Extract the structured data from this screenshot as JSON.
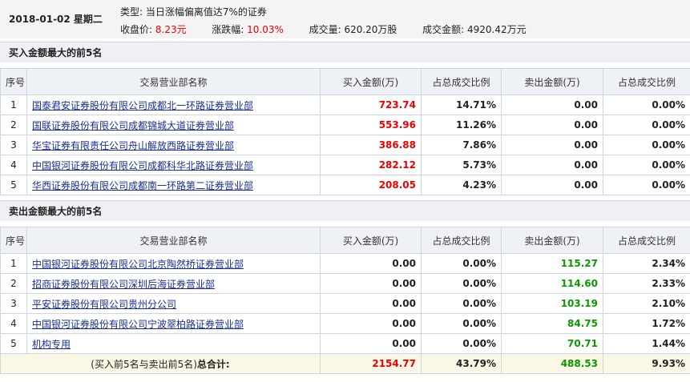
{
  "header": {
    "date": "2018-01-02 星期二",
    "type_label": "类型:",
    "type_value": "当日涨幅偏离值达7%的证券",
    "close_label": "收盘价:",
    "close_value": "8.23元",
    "change_label": "涨跌幅:",
    "change_value": "10.03%",
    "volume_label": "成交量:",
    "volume_value": "620.20万股",
    "amount_label": "成交金额:",
    "amount_value": "4920.42万元"
  },
  "buy_section": {
    "title": "买入金额最大的前5名",
    "columns": [
      "序号",
      "交易营业部名称",
      "买入金额(万)",
      "占总成交比例",
      "卖出金额(万)",
      "占总成交比例"
    ],
    "rows": [
      {
        "no": "1",
        "name": "国泰君安证券股份有限公司成都北一环路证券营业部",
        "buy": "723.74",
        "buy_pct": "14.71%",
        "sell": "0.00",
        "sell_pct": "0.00%"
      },
      {
        "no": "2",
        "name": "国联证券股份有限公司成都锦城大道证券营业部",
        "buy": "553.96",
        "buy_pct": "11.26%",
        "sell": "0.00",
        "sell_pct": "0.00%"
      },
      {
        "no": "3",
        "name": "华宝证券有限责任公司舟山解放西路证券营业部",
        "buy": "386.88",
        "buy_pct": "7.86%",
        "sell": "0.00",
        "sell_pct": "0.00%"
      },
      {
        "no": "4",
        "name": "中国银河证券股份有限公司成都科华北路证券营业部",
        "buy": "282.12",
        "buy_pct": "5.73%",
        "sell": "0.00",
        "sell_pct": "0.00%"
      },
      {
        "no": "5",
        "name": "华西证券股份有限公司成都南一环路第二证券营业部",
        "buy": "208.05",
        "buy_pct": "4.23%",
        "sell": "0.00",
        "sell_pct": "0.00%"
      }
    ]
  },
  "sell_section": {
    "title": "卖出金额最大的前5名",
    "columns": [
      "序号",
      "交易营业部名称",
      "买入金额(万)",
      "占总成交比例",
      "卖出金额(万)",
      "占总成交比例"
    ],
    "rows": [
      {
        "no": "1",
        "name": "中国银河证券股份有限公司北京陶然桥证券营业部",
        "buy": "0.00",
        "buy_pct": "0.00%",
        "sell": "115.27",
        "sell_pct": "2.34%"
      },
      {
        "no": "2",
        "name": "招商证券股份有限公司深圳后海证券营业部",
        "buy": "0.00",
        "buy_pct": "0.00%",
        "sell": "114.60",
        "sell_pct": "2.33%"
      },
      {
        "no": "3",
        "name": "平安证券股份有限公司贵州分公司",
        "buy": "0.00",
        "buy_pct": "0.00%",
        "sell": "103.19",
        "sell_pct": "2.10%"
      },
      {
        "no": "4",
        "name": "中国银河证券股份有限公司宁波翠柏路证券营业部",
        "buy": "0.00",
        "buy_pct": "0.00%",
        "sell": "84.75",
        "sell_pct": "1.72%"
      },
      {
        "no": "5",
        "name": "机构专用",
        "buy": "0.00",
        "buy_pct": "0.00%",
        "sell": "70.71",
        "sell_pct": "1.44%"
      }
    ],
    "total": {
      "label_prefix": "(买入前5名与卖出前5名)",
      "label_bold": "总合计:",
      "buy": "2154.77",
      "buy_pct": "43.79%",
      "sell": "488.53",
      "sell_pct": "9.93%"
    }
  },
  "colors": {
    "buy_value": "#e00000",
    "sell_value": "#0a9900",
    "link": "#1a2d9a"
  }
}
